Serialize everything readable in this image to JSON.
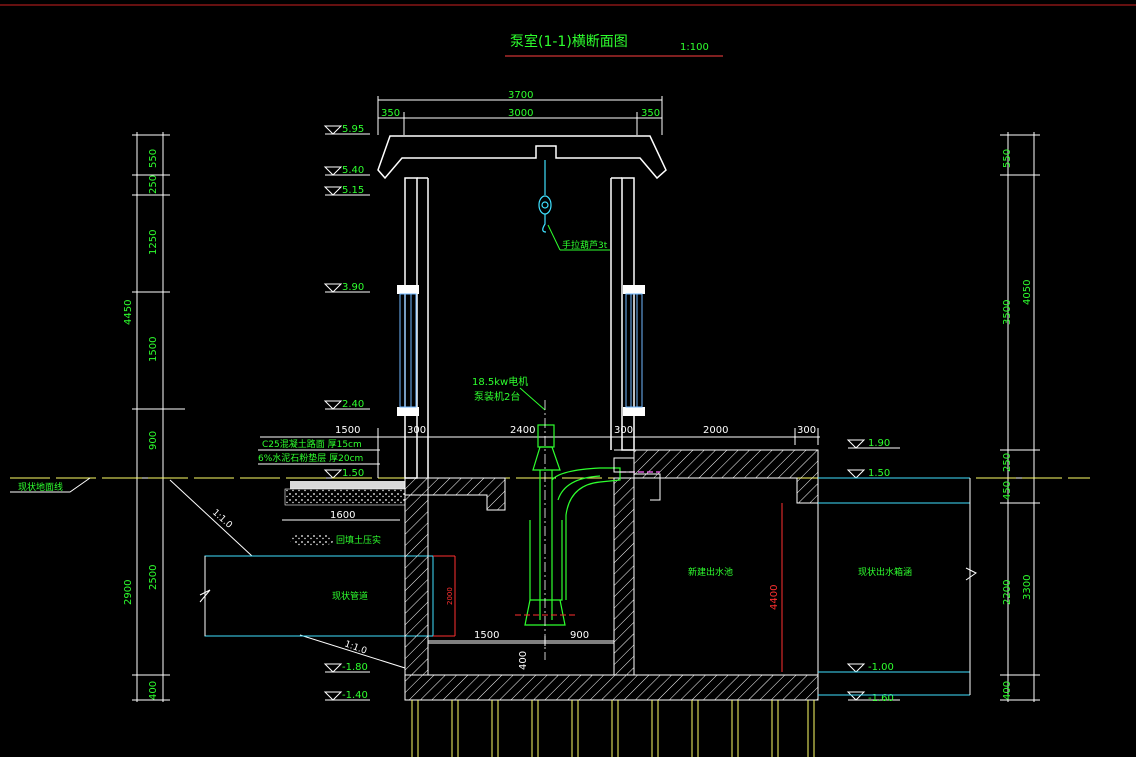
{
  "drawing": {
    "title": "泵室(1-1)横断面图",
    "scale": "1:100"
  },
  "top_dims": {
    "total": "3700",
    "left": "350",
    "mid": "3000",
    "right": "350"
  },
  "elev_left": [
    "5.95",
    "5.40",
    "5.15",
    "3.90",
    "2.40",
    "1.50",
    "-1.80",
    "-1.40"
  ],
  "elev_right": [
    "1.90",
    "1.50",
    "-1.00",
    "-1.60"
  ],
  "vdims_left": [
    "550",
    "250",
    "1250",
    "4450",
    "1500",
    "900",
    "2500",
    "2900",
    "400"
  ],
  "vdims_right": [
    "550",
    "3500",
    "4050",
    "250",
    "450",
    "2200",
    "3300",
    "400"
  ],
  "labels": {
    "hoist": "手拉葫芦3t",
    "motor_line1": "18.5kw电机",
    "motor_line2": "泵装机2台",
    "pave1": "C25混凝土路面 厚15cm",
    "pave2": "6%水泥石粉垫层 厚20cm",
    "ground": "现状地面线",
    "slope": "1:1.0",
    "slope2": "1:1.0",
    "backfill": "回填土压实",
    "pipe_left": "现状管道",
    "outlet_pool": "新建出水池",
    "outlet_culvert": "现状出水箱涵",
    "dim_1600": "1600",
    "dim_2000_small": "2000",
    "dim_4400": "4400"
  },
  "hdims_mid": [
    "1500",
    "300",
    "2400",
    "300",
    "2000",
    "300"
  ],
  "hdims_low": [
    "1500",
    "900",
    "400"
  ]
}
